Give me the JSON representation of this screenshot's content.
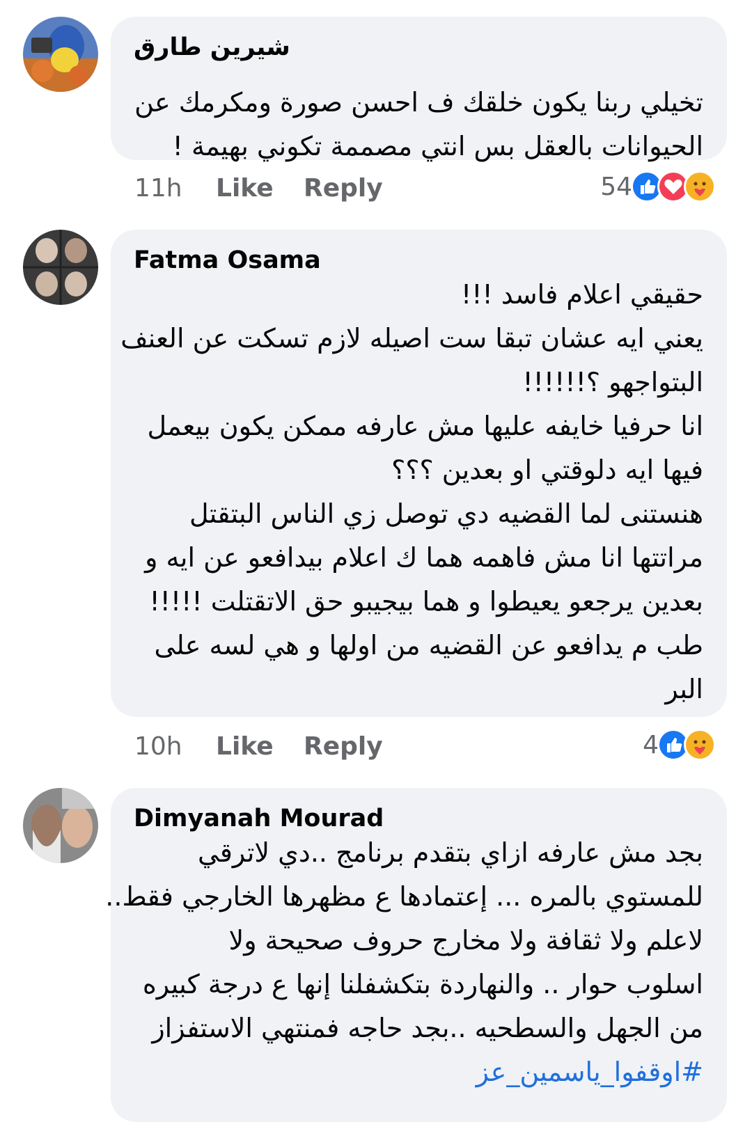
{
  "comments": [
    {
      "author": "شيرين طارق",
      "lines": [
        "تخيلي ربنا يكون خلقك ف احسن صورة ومكرمك عن",
        "الحيوانات بالعقل بس انتي مصممة تكوني بهيمة !"
      ],
      "time": "11h",
      "like_label": "Like",
      "reply_label": "Reply",
      "reaction_count": "54",
      "reactions": [
        "like-icon",
        "love-icon",
        "care-icon"
      ]
    },
    {
      "author": "Fatma Osama",
      "lines": [
        "حقيقي اعلام فاسد !!!",
        "يعني ايه عشان تبقا ست اصيله لازم تسكت عن العنف",
        "البتواجهو ؟!!!!!!",
        "انا حرفيا خايفه عليها مش عارفه ممكن يكون بيعمل",
        "فيها ايه دلوقتي او بعدين ؟؟؟",
        "هنستنى لما القضيه دي توصل زي الناس البتقتل",
        "مراتتها انا مش فاهمه هما ك اعلام بيدافعو عن ايه و",
        "بعدين يرجعو يعيطوا و هما بيجيبو حق الاتقتلت !!!!!",
        "طب م يدافعو عن القضيه من اولها و هي لسه على",
        "البر"
      ],
      "time": "10h",
      "like_label": "Like",
      "reply_label": "Reply",
      "reaction_count": "4",
      "reactions": [
        "like-icon",
        "care-icon"
      ]
    },
    {
      "author": "Dimyanah Mourad",
      "lines": [
        "بجد مش عارفه ازاي بتقدم برنامج ..دي لاترقي",
        "للمستوي بالمره ... إعتمادها ع مظهرها الخارجي فقط..",
        "لاعلم ولا ثقافة ولا مخارج حروف صحيحة ولا",
        "اسلوب حوار .. والنهاردة بتكشفلنا إنها ع درجة كبيره",
        "من الجهل والسطحيه ..بجد حاجه فمنتهي الاستفزاز"
      ],
      "hashtag": "#اوقفوا_ياسمين_عز"
    }
  ],
  "colors": {
    "bubble": "#f0f2f5",
    "text": "#050505",
    "meta": "#65676b",
    "link": "#216fdb",
    "like": "#1877f2",
    "love": "#f33e58",
    "care": "#f7b125"
  }
}
